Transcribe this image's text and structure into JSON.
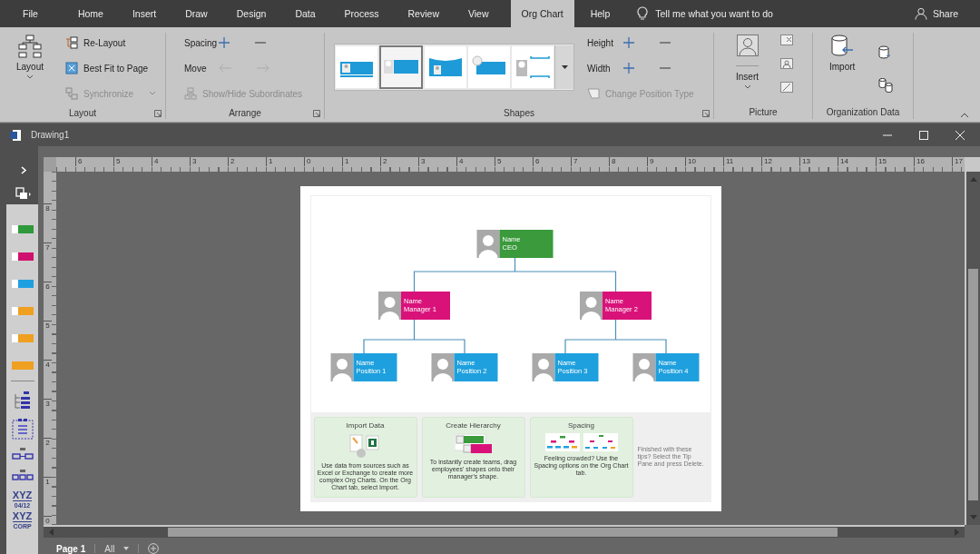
{
  "menu": {
    "tabs": [
      {
        "label": "File",
        "selected": false
      },
      {
        "label": "Home",
        "selected": false
      },
      {
        "label": "Insert",
        "selected": false
      },
      {
        "label": "Draw",
        "selected": false
      },
      {
        "label": "Design",
        "selected": false
      },
      {
        "label": "Data",
        "selected": false
      },
      {
        "label": "Process",
        "selected": false
      },
      {
        "label": "Review",
        "selected": false
      },
      {
        "label": "View",
        "selected": false
      },
      {
        "label": "Org Chart",
        "selected": true
      },
      {
        "label": "Help",
        "selected": false
      }
    ],
    "tell_me": "Tell me what you want to do",
    "share": "Share"
  },
  "ribbon": {
    "layout_group": {
      "label": "Layout",
      "layout_button": "Layout",
      "relayout": "Re-Layout",
      "best_fit": "Best Fit to Page",
      "synchronize": {
        "label": "Synchronize",
        "disabled": true
      }
    },
    "arrange_group": {
      "label": "Arrange",
      "spacing": "Spacing",
      "move": {
        "label": "Move",
        "disabled": true
      },
      "show_hide": {
        "label": "Show/Hide Subordinates",
        "disabled": true
      }
    },
    "shapes_group": {
      "label": "Shapes",
      "gallery": [
        {
          "kind": "banner",
          "selected": false
        },
        {
          "kind": "block",
          "selected": true
        },
        {
          "kind": "wave",
          "selected": false
        },
        {
          "kind": "round",
          "selected": false
        },
        {
          "kind": "bracket",
          "selected": false
        }
      ],
      "height": "Height",
      "width": "Width",
      "change_position_type": {
        "label": "Change Position Type",
        "disabled": true
      }
    },
    "picture_group": {
      "label": "Picture",
      "insert": "Insert"
    },
    "org_data_group": {
      "label": "Organization Data",
      "import": "Import"
    }
  },
  "document": {
    "title": "Drawing1"
  },
  "stencil": {
    "shapes": [
      {
        "kind": "photo-card",
        "color": "#2e9a3a"
      },
      {
        "kind": "photo-card",
        "color": "#d0106e"
      },
      {
        "kind": "photo-card",
        "color": "#1ea0e0"
      },
      {
        "kind": "photo-card",
        "color": "#f0a020"
      },
      {
        "kind": "photo-card",
        "color": "#f0a020"
      },
      {
        "kind": "bar",
        "color": "#f0a020"
      }
    ],
    "samples": [
      {
        "title": "XYZ",
        "subtitle": "04/12"
      },
      {
        "title": "XYZ",
        "subtitle": "CORP"
      }
    ]
  },
  "rulers": {
    "horizontal": [
      "6",
      "5",
      "4",
      "3",
      "2",
      "1",
      "0",
      "1",
      "2",
      "3",
      "4",
      "5",
      "6",
      "7",
      "8",
      "9",
      "10",
      "11",
      "12",
      "13",
      "14",
      "15",
      "16",
      "17"
    ],
    "vertical": [
      "8",
      "7",
      "6",
      "5",
      "4",
      "3",
      "2",
      "1",
      "0"
    ]
  },
  "org_chart": {
    "root": {
      "name": "Name",
      "title": "CEO",
      "color": "#3a9a3c",
      "children": [
        {
          "name": "Name",
          "title": "Manager 1",
          "color": "#d9127a",
          "children": [
            {
              "name": "Name",
              "title": "Position 1",
              "color": "#1fa0de"
            },
            {
              "name": "Name",
              "title": "Position 2",
              "color": "#1fa0de"
            }
          ]
        },
        {
          "name": "Name",
          "title": "Manager 2",
          "color": "#d9127a",
          "children": [
            {
              "name": "Name",
              "title": "Position 3",
              "color": "#1fa0de"
            },
            {
              "name": "Name",
              "title": "Position 4",
              "color": "#1fa0de"
            }
          ]
        }
      ]
    }
  },
  "tips": {
    "cards": [
      {
        "kind": "import",
        "title": "Import Data",
        "text": "Use data from sources such as Excel or Exchange to create more complex Org Charts. On the Org Chart tab, select Import."
      },
      {
        "kind": "hierarchy",
        "title": "Create Hierarchy",
        "text": "To instantly create teams, drag employees' shapes onto their manager's shape."
      },
      {
        "kind": "spacing",
        "title": "Spacing",
        "text": "Feeling crowded? Use the Spacing options on the Org Chart tab."
      }
    ],
    "note": "Finished with these tips? Select the Tip Pane and press Delete."
  },
  "page_tabs": {
    "pages": [
      {
        "label": "Page 1",
        "selected": true
      }
    ],
    "all": "All"
  }
}
